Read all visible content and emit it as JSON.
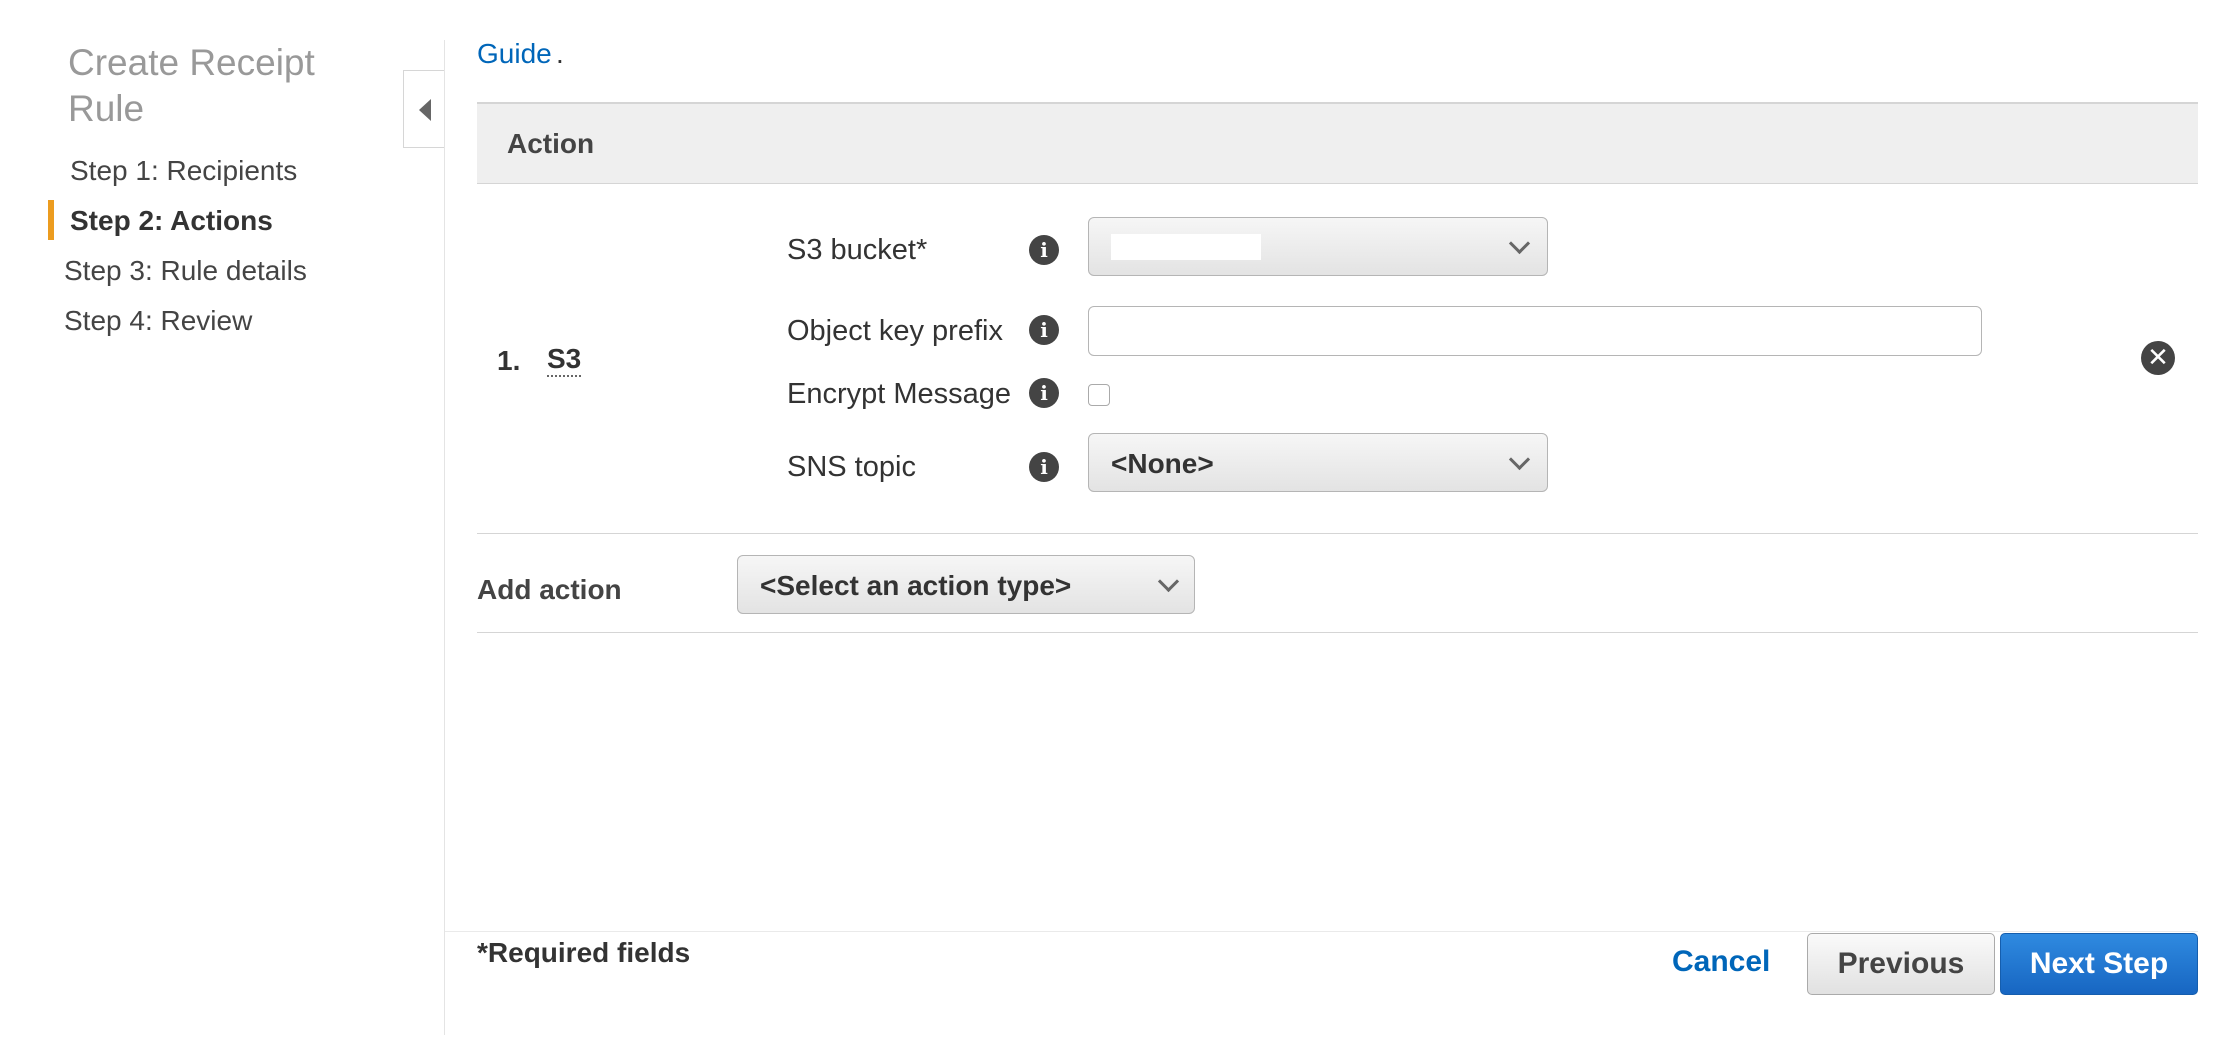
{
  "sidebar": {
    "title": "Create Receipt Rule",
    "steps": [
      {
        "label": "Step 1: Recipients"
      },
      {
        "label": "Step 2: Actions"
      },
      {
        "label": "Step 3: Rule details"
      },
      {
        "label": "Step 4: Review"
      }
    ],
    "active_step": 1,
    "accent_color": "#ec9c1f",
    "collapse_icon": "triangle-left-icon"
  },
  "intro": {
    "guide_link": "Guide",
    "guide_suffix": "."
  },
  "actions": {
    "header": "Action",
    "items": [
      {
        "number": "1.",
        "type": "S3",
        "fields": {
          "s3_bucket": {
            "label": "S3 bucket*",
            "value": ""
          },
          "object_key_prefix": {
            "label": "Object key prefix",
            "value": ""
          },
          "encrypt_message": {
            "label": "Encrypt Message",
            "checked": false
          },
          "sns_topic": {
            "label": "SNS topic",
            "value": "<None>"
          }
        },
        "remove_icon": "remove-circle-icon"
      }
    ],
    "add": {
      "label": "Add action",
      "select_value": "<Select an action type>"
    }
  },
  "footer": {
    "required_note": "*Required fields",
    "cancel": "Cancel",
    "previous": "Previous",
    "next": "Next Step"
  },
  "colors": {
    "link": "#0066b9",
    "primary_button": "#1766c2",
    "header_bg": "#efefef"
  }
}
